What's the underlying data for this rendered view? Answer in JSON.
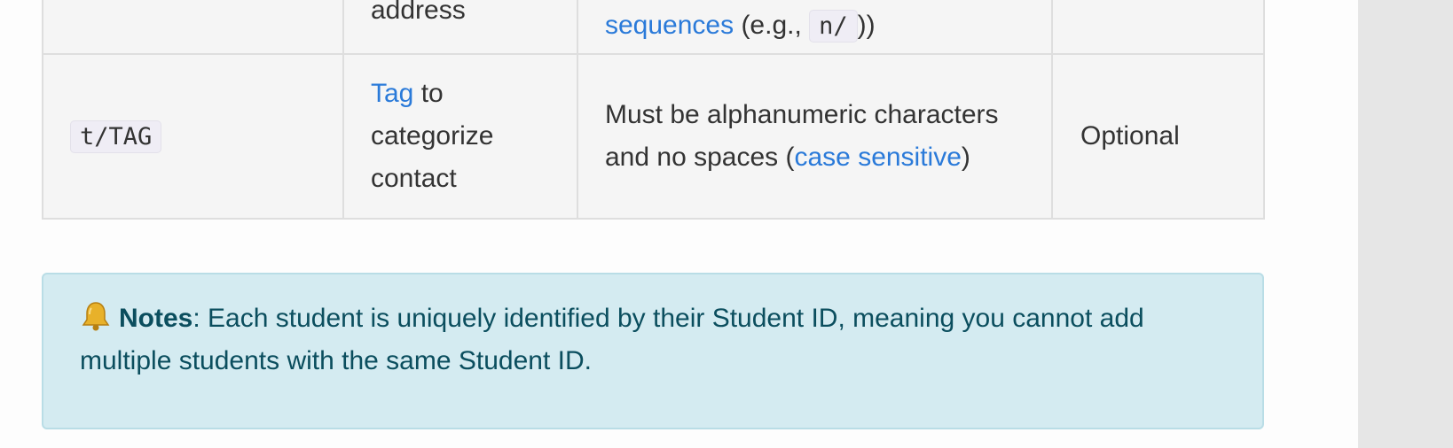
{
  "table": {
    "row_prev": {
      "desc_partial": "address",
      "constraint_link": "sequences",
      "constraint_text": " (e.g., ",
      "constraint_code": "n/",
      "constraint_close": ")"
    },
    "row_tag": {
      "parameter": "t/TAG",
      "desc_link": "Tag",
      "desc_text": " to categorize contact",
      "constraint_text": "Must be alphanumeric characters and no spaces (",
      "constraint_link": "case sensitive",
      "constraint_close": ")",
      "requirement": "Optional"
    }
  },
  "notes": {
    "icon": "bell-icon",
    "label": "Notes",
    "text": ": Each student is uniquely identified by their Student ID, meaning you cannot add multiple students with the same Student ID."
  },
  "colors": {
    "link": "#2a7ad9",
    "notes_bg": "#d4ebf1",
    "notes_text": "#0b4e5e"
  }
}
